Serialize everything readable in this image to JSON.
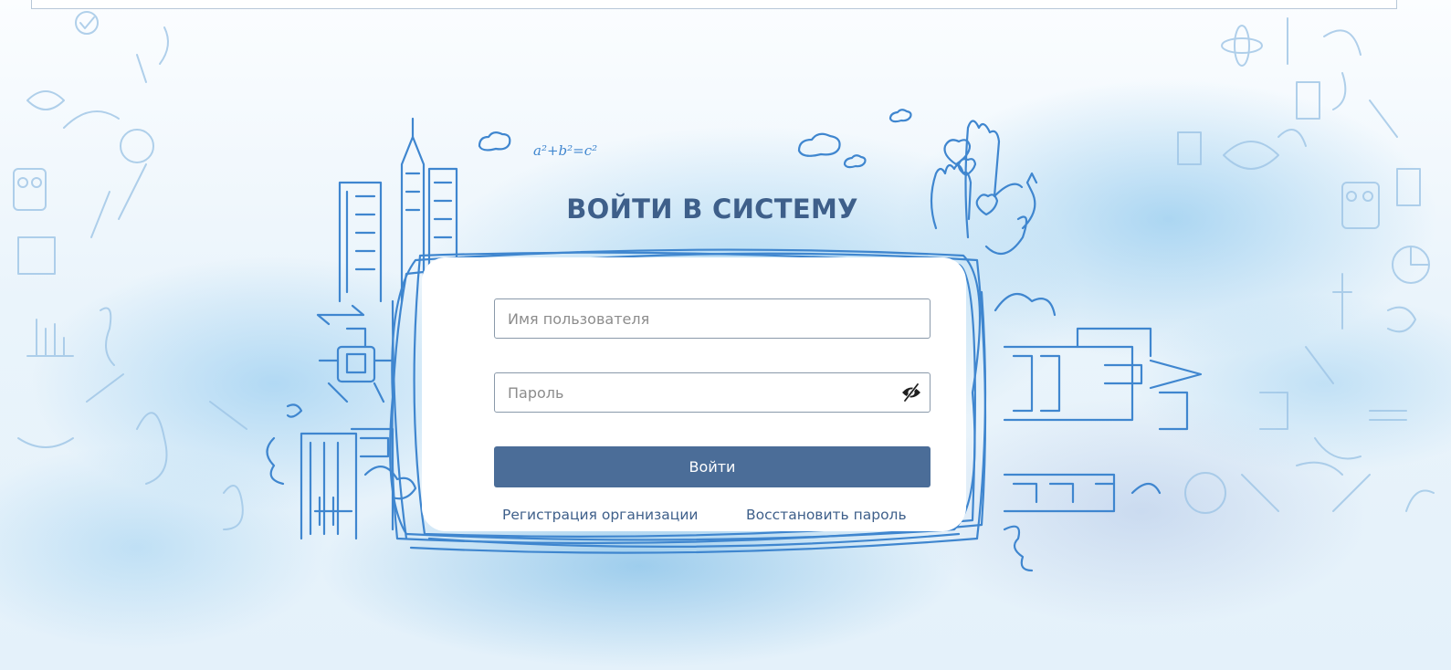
{
  "login": {
    "title": "ВОЙТИ В СИСТЕМУ",
    "username_placeholder": "Имя пользователя",
    "password_placeholder": "Пароль",
    "password_toggle_icon": "eye-slash-icon",
    "submit_label": "Войти",
    "register_link": "Регистрация организации",
    "restore_link": "Восстановить пароль"
  },
  "decorations": {
    "formula": "a²+b²=c²"
  },
  "colors": {
    "accent": "#4b6d98",
    "title": "#3e5f8a",
    "sketch": "#3f86cf"
  }
}
